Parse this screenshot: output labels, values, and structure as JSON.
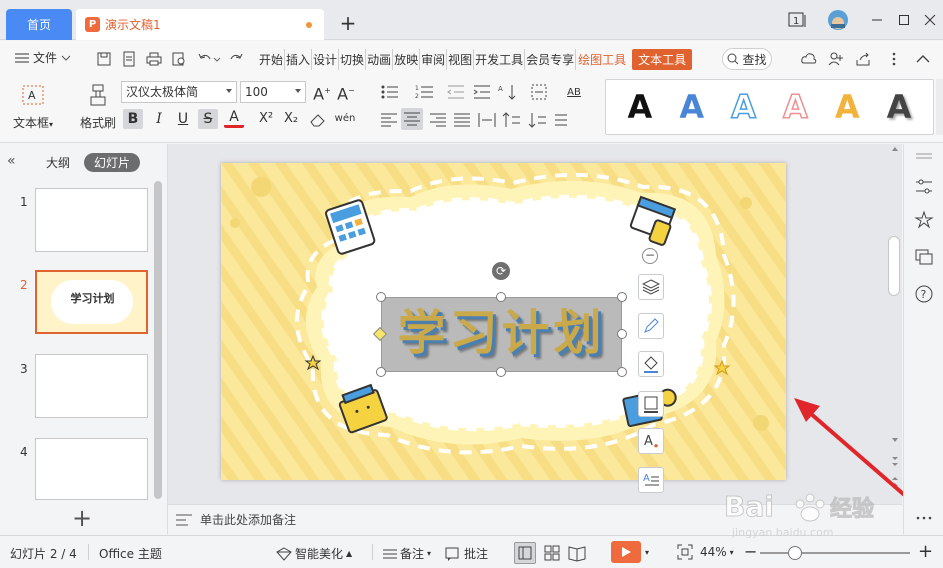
{
  "tabs": {
    "home": "首页",
    "document": "演示文稿1"
  },
  "window": {
    "badge": "1"
  },
  "menu": {
    "file": "文件",
    "tabs": [
      "开始",
      "插入",
      "设计",
      "切换",
      "动画",
      "放映",
      "审阅",
      "视图",
      "开发工具",
      "会员专享"
    ],
    "drawing_tools": "绘图工具",
    "text_tools": "文本工具",
    "search": "查找"
  },
  "ribbon": {
    "textbox": "文本框",
    "format_painter": "格式刷",
    "font_name": "汉仪太极体简",
    "font_size": "100",
    "bold": "B",
    "italic": "I",
    "underline": "U",
    "strike": "S",
    "font_color": "A",
    "superscript": "X²",
    "subscript": "X₂",
    "phonetic": "wén",
    "align_label": "AB",
    "style_glyph": "A",
    "style_colors": [
      "#111111",
      "#4a86d8",
      "#4a9ee0",
      "#f08f8f",
      "#f2b33d",
      "#444444"
    ]
  },
  "panel": {
    "outline_tab": "大纲",
    "slides_tab": "幻灯片",
    "slides": [
      {
        "num": "1"
      },
      {
        "num": "2",
        "title": "学习计划"
      },
      {
        "num": "3"
      },
      {
        "num": "4"
      }
    ],
    "add": "+"
  },
  "slide": {
    "title_text": "学习计划"
  },
  "notes": {
    "placeholder": "单击此处添加备注"
  },
  "status": {
    "slide_position": "幻灯片 2 / 4",
    "theme": "Office 主题",
    "smart_beautify": "智能美化",
    "notes": "备注",
    "comments": "批注",
    "zoom": "44%",
    "zoom_out": "−",
    "zoom_in": "+"
  },
  "watermark": {
    "text": "Bai",
    "text2": "经验",
    "sub": "jingyan.baidu.com"
  },
  "colors": {
    "accent": "#e0622f",
    "home_tab": "#4a8af4",
    "slide_bg": "#fbe89a",
    "arrow": "#e0262b"
  }
}
